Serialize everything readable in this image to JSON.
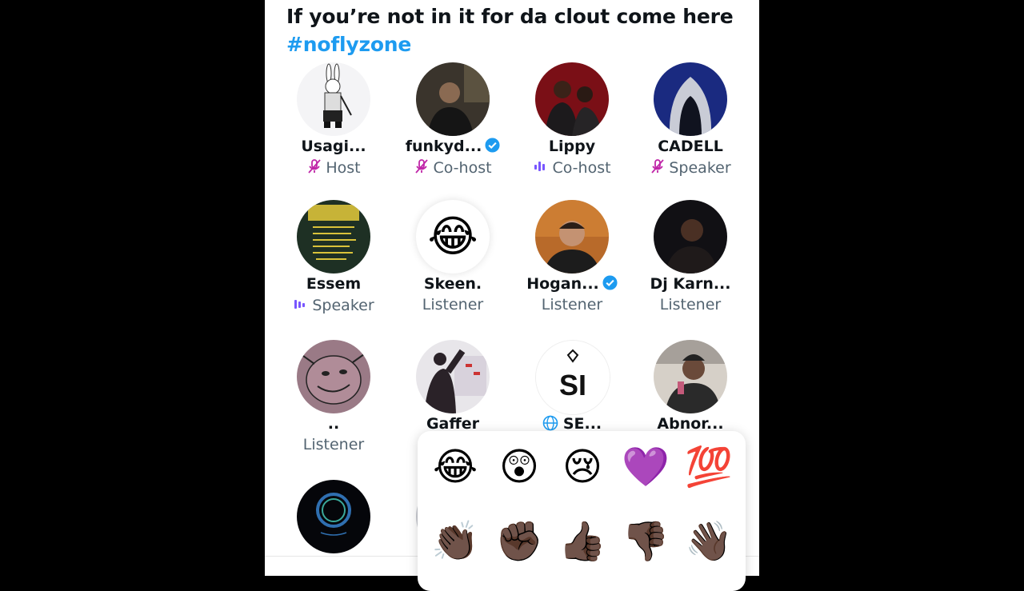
{
  "space": {
    "title": "If you’re not in it for da clout come here",
    "hashtag": "#noflyzone"
  },
  "participants": [
    {
      "name": "Usagi...",
      "role": "Host",
      "role_icon": "mic-off-icon",
      "verified": false
    },
    {
      "name": "funkyd...",
      "role": "Co-host",
      "role_icon": "mic-off-icon",
      "verified": true
    },
    {
      "name": "Lippy",
      "role": "Co-host",
      "role_icon": "speaking-bars-icon",
      "verified": false
    },
    {
      "name": "CADELL",
      "role": "Speaker",
      "role_icon": "mic-off-icon",
      "verified": false
    },
    {
      "name": "Essem",
      "role": "Speaker",
      "role_icon": "speaking-bars-icon",
      "verified": false
    },
    {
      "name": "Skeen.",
      "role": "Listener",
      "role_icon": "",
      "verified": false
    },
    {
      "name": "Hogan...",
      "role": "Listener",
      "role_icon": "",
      "verified": true
    },
    {
      "name": "Dj Karn...",
      "role": "Listener",
      "role_icon": "",
      "verified": false
    },
    {
      "name": "..",
      "role": "Listener",
      "role_icon": "",
      "verified": false
    },
    {
      "name": "Gaffer",
      "role": "",
      "role_icon": "",
      "verified": false
    },
    {
      "name": "SE...",
      "role": "",
      "role_icon": "globe-icon",
      "verified": false
    },
    {
      "name": "Abnor...",
      "role": "",
      "role_icon": "",
      "verified": false
    }
  ],
  "avatar_glyphs": {
    "skeen": "😂",
    "si_logo": "SI"
  },
  "reactions": [
    "😂",
    "😲",
    "😢",
    "💜",
    "💯",
    "👏🏿",
    "✊🏿",
    "👍🏿",
    "👎🏿",
    "👋🏿"
  ],
  "colors": {
    "accent": "#1d9bf0",
    "mic_off": "#c026a8",
    "speaking": "#7856ff",
    "text": "#0f1419",
    "secondary": "#536471"
  }
}
